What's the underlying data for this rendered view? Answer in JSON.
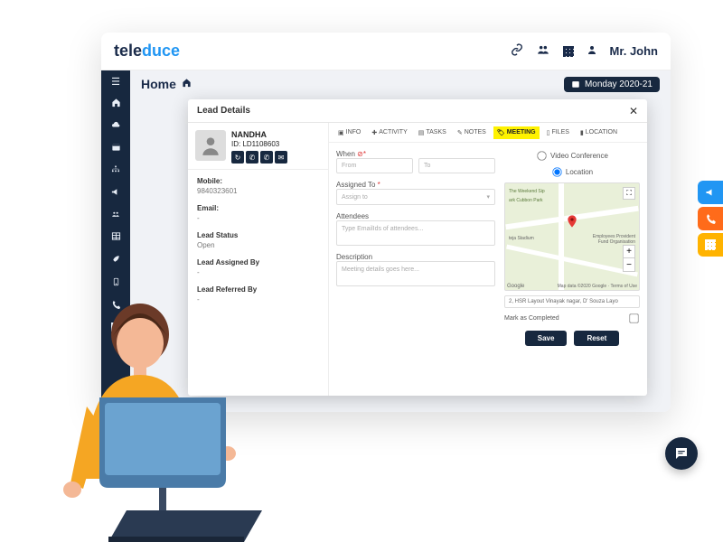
{
  "brand": {
    "part1": "tele",
    "part2": "duce"
  },
  "user": {
    "name": "Mr. John"
  },
  "breadcrumb": {
    "title": "Home"
  },
  "dateBadge": "Monday 2020-21",
  "modal": {
    "title": "Lead Details",
    "lead": {
      "name": "NANDHA",
      "id": "ID: LD1108603"
    },
    "fields": {
      "mobile_lbl": "Mobile:",
      "mobile_val": "9840323601",
      "email_lbl": "Email:",
      "email_val": "-",
      "status_lbl": "Lead Status",
      "status_val": "Open",
      "assigned_lbl": "Lead Assigned By",
      "assigned_val": "-",
      "referred_lbl": "Lead Referred By",
      "referred_val": "-"
    },
    "tabs": {
      "info": "INFO",
      "activity": "ACTIVITY",
      "tasks": "TASKS",
      "notes": "NOTES",
      "meeting": "MEETING",
      "files": "FILES",
      "location": "LOCATION"
    },
    "form": {
      "when_lbl": "When",
      "from_ph": "From",
      "to_ph": "To",
      "assigned_lbl": "Assigned To",
      "assigned_ph": "Assign to",
      "attendees_lbl": "Attendees",
      "attendees_ph": "Type EmailIds of attendees...",
      "desc_lbl": "Description",
      "desc_ph": "Meeting details goes here..."
    },
    "mapPanel": {
      "videoconf": "Video Conference",
      "location": "Location",
      "address": "2, HSR Layout Vinayak nagar, D' Souza Layo",
      "mark": "Mark as Completed",
      "mapLabels": {
        "a": "The Weekend Sip",
        "b": "ark Cubbon Park",
        "c": "teja Stadium",
        "d": "Employees Provident Fund Organisation"
      },
      "save": "Save",
      "reset": "Reset"
    }
  }
}
